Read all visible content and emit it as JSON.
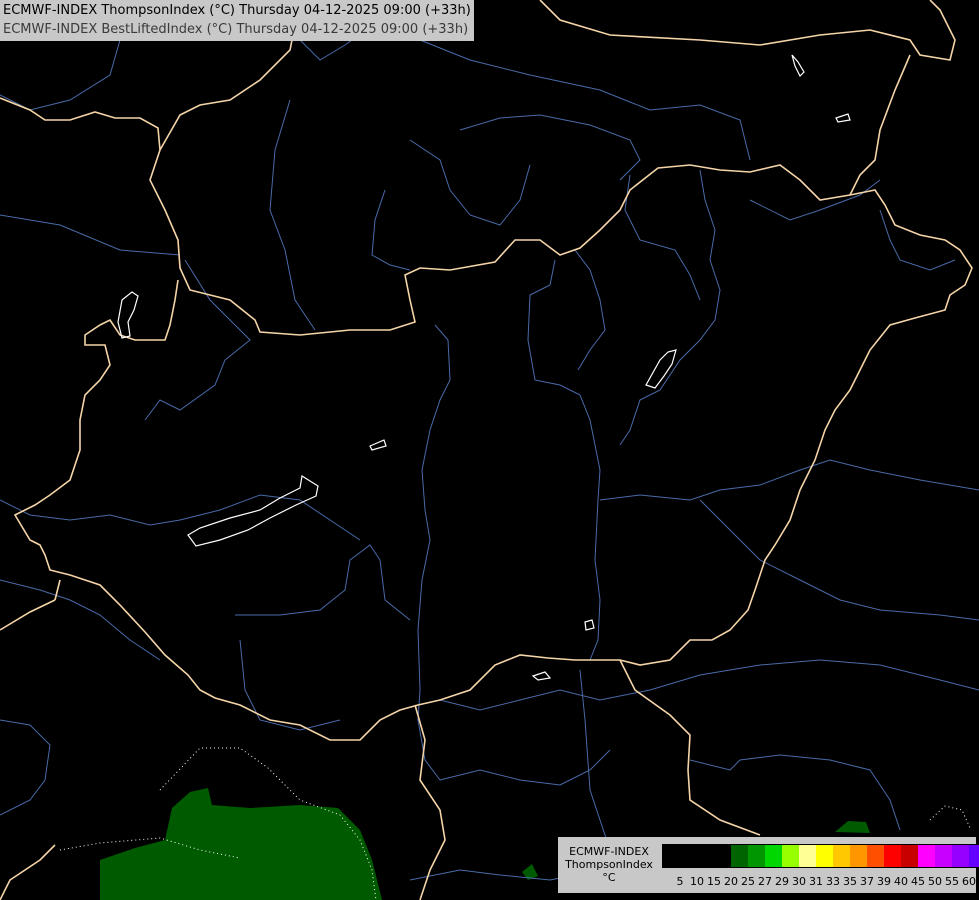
{
  "titles": [
    "ECMWF-INDEX ThompsonIndex (°C) Thursday 04-12-2025 09:00 (+33h)",
    "ECMWF-INDEX BestLiftedIndex (°C) Thursday 04-12-2025 09:00 (+33h)"
  ],
  "legend": {
    "source": "ECMWF-INDEX",
    "parameter": "ThompsonIndex",
    "unit": "°C",
    "colors": [
      "#000000",
      "#000000",
      "#000000",
      "#000000",
      "#006400",
      "#009600",
      "#00d700",
      "#96ff00",
      "#ffff96",
      "#ffff00",
      "#ffc800",
      "#ff9600",
      "#ff5000",
      "#ff0000",
      "#c80000",
      "#ff00ff",
      "#c800ff",
      "#9600ff",
      "#6400ff",
      "#0000ff"
    ],
    "ticks": [
      "5",
      "10",
      "15",
      "20",
      "25",
      "27",
      "29",
      "30",
      "31",
      "33",
      "35",
      "37",
      "39",
      "40",
      "45",
      "50",
      "55",
      "60"
    ]
  },
  "map_colors": {
    "background": "#000000",
    "border": "#f5d5a8",
    "river": "#4a6aa8",
    "lake_outline": "#ffffff",
    "field_dark_green": "#005a00"
  }
}
